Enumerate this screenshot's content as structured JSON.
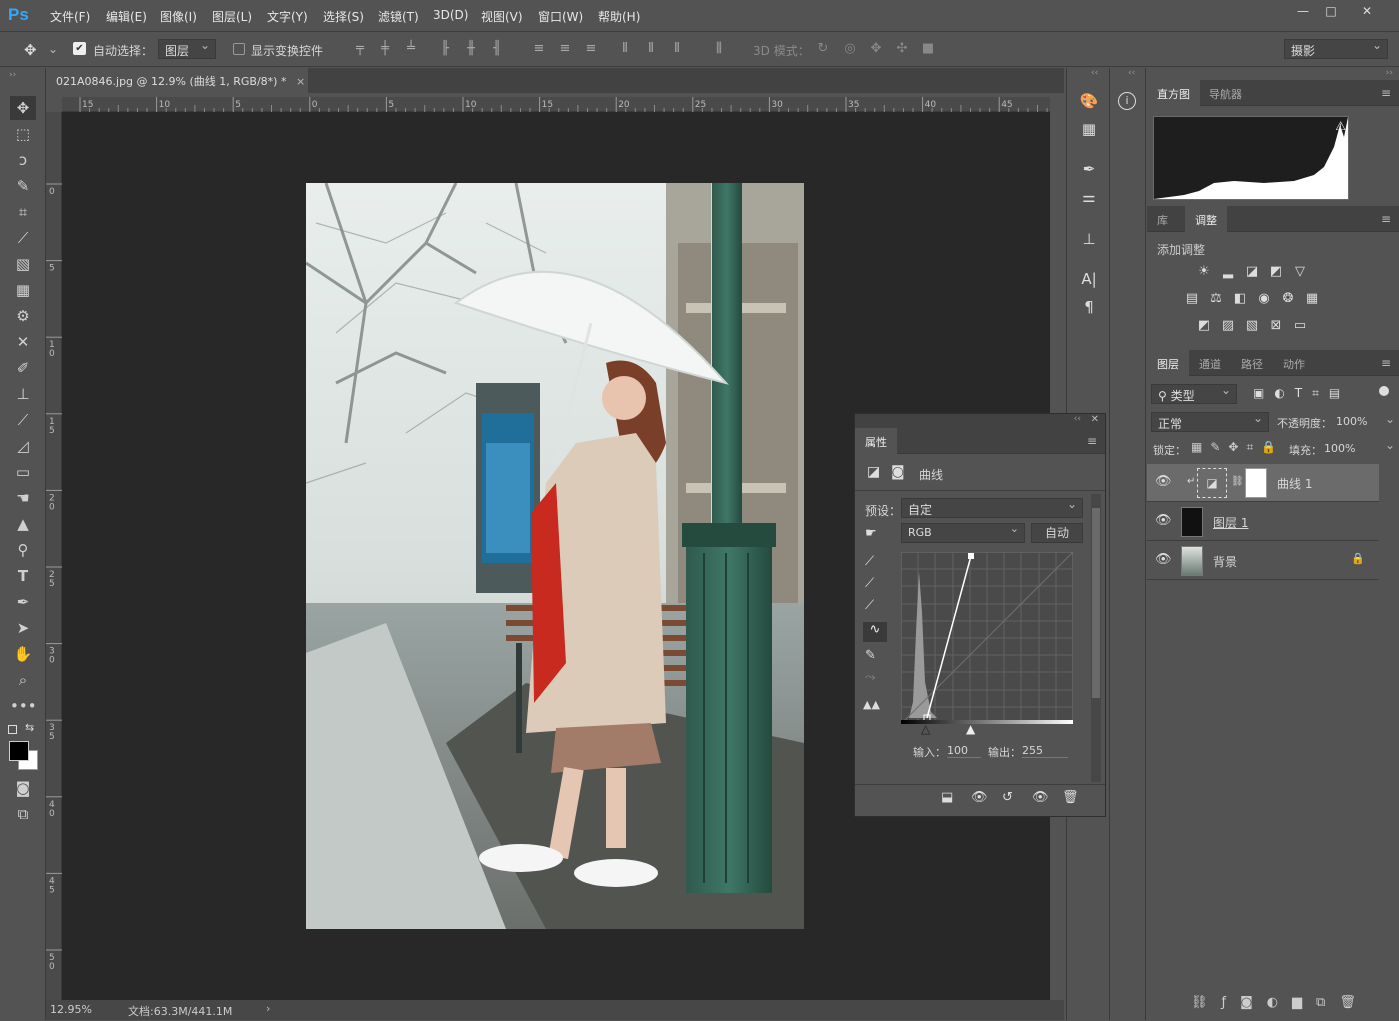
{
  "app": {
    "logo": "Ps"
  },
  "menu": [
    "文件(F)",
    "编辑(E)",
    "图像(I)",
    "图层(L)",
    "文字(Y)",
    "选择(S)",
    "滤镜(T)",
    "3D(D)",
    "视图(V)",
    "窗口(W)",
    "帮助(H)"
  ],
  "window_controls": {
    "minimize": "—",
    "restore": "□",
    "close": "✕"
  },
  "options": {
    "auto_select_label": "自动选择：",
    "auto_select_value": "图层",
    "show_transform_label": "显示变换控件",
    "mode_3d_label": "3D 模式：",
    "workspace": "摄影"
  },
  "document": {
    "tab_title": "021A0846.jpg @ 12.9% (曲线 1, RGB/8*) *",
    "close": "×",
    "zoom": "12.95%",
    "doc_info": "文档:63.3M/441.1M"
  },
  "ruler": {
    "top_ticks": [
      "15",
      "10",
      "5",
      "0",
      "5",
      "10",
      "15",
      "20",
      "25",
      "30",
      "35",
      "40",
      "45"
    ],
    "left_ticks": [
      "0",
      "5",
      "1 0",
      "1 5",
      "2 0",
      "2 5",
      "3 0",
      "3 5",
      "4 0",
      "4 5",
      "5 0"
    ]
  },
  "histogram_panel": {
    "tabs": [
      "直方图",
      "导航器"
    ],
    "warning_icon": "⚠"
  },
  "adjustments_panel": {
    "tabs": [
      "库",
      "调整"
    ],
    "title": "添加调整"
  },
  "layers_panel": {
    "tabs": [
      "图层",
      "通道",
      "路径",
      "动作"
    ],
    "filter_label": "类型",
    "blend_mode": "正常",
    "opacity_label": "不透明度：",
    "opacity": "100%",
    "lock_label": "锁定：",
    "fill_label": "填充：",
    "fill": "100%",
    "layers": [
      {
        "name": "曲线 1"
      },
      {
        "name": "图层 1"
      },
      {
        "name": "背景"
      }
    ]
  },
  "properties_panel": {
    "tab": "属性",
    "title": "曲线",
    "preset_label": "预设：",
    "preset_value": "自定",
    "channel": "RGB",
    "auto_button": "自动",
    "input_label": "输入：",
    "input_value": "100",
    "output_label": "输出：",
    "output_value": "255"
  }
}
